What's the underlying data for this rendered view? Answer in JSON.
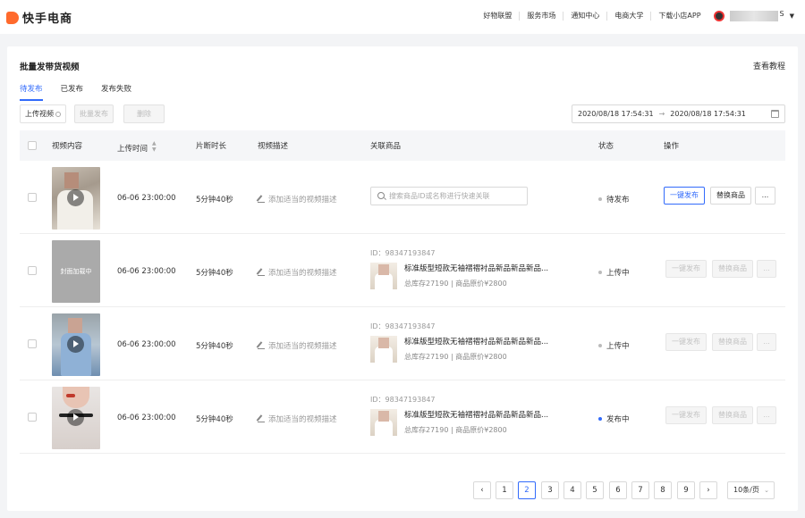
{
  "header": {
    "logo_text": "快手电商",
    "nav": [
      "好物联盟",
      "服务市场",
      "通知中心",
      "电商大学",
      "下载小店APP"
    ],
    "user_suffix": "S"
  },
  "page": {
    "title": "批量发带货视频",
    "tutorial_link": "查看教程",
    "tabs": [
      "待发布",
      "已发布",
      "发布失败"
    ],
    "toolbar": {
      "upload": "上传视频",
      "batch_publish": "批量发布",
      "delete": "删除"
    },
    "date_start": "2020/08/18 17:54:31",
    "date_end": "2020/08/18 17:54:31"
  },
  "table": {
    "headers": [
      "视频内容",
      "上传时间",
      "片断时长",
      "视频描述",
      "关联商品",
      "状态",
      "操作"
    ],
    "rows": [
      {
        "upload_time": "06-06 23:00:00",
        "duration": "5分钟40秒",
        "description": "添加适当的视频描述",
        "search_placeholder": "搜索商品ID或名称进行快速关联",
        "status": "待发布",
        "status_color": "#bbbbbb"
      },
      {
        "thumb_loading": "封面加载中",
        "upload_time": "06-06 23:00:00",
        "duration": "5分钟40秒",
        "description": "添加适当的视频描述",
        "product_id": "ID：98347193847",
        "product_name": "标准版型短款无袖褶褶衬品新品新品新品...",
        "product_stock": "总库存27190 | 商品原价¥2800",
        "status": "上传中",
        "status_color": "#bbbbbb"
      },
      {
        "upload_time": "06-06 23:00:00",
        "duration": "5分钟40秒",
        "description": "添加适当的视频描述",
        "product_id": "ID：98347193847",
        "product_name": "标准版型短款无袖褶褶衬品新品新品新品...",
        "product_stock": "总库存27190 | 商品原价¥2800",
        "status": "上传中",
        "status_color": "#bbbbbb"
      },
      {
        "upload_time": "06-06 23:00:00",
        "duration": "5分钟40秒",
        "description": "添加适当的视频描述",
        "product_id": "ID：98347193847",
        "product_name": "标准版型短款无袖褶褶衬品新品新品新品...",
        "product_stock": "总库存27190 | 商品原价¥2800",
        "status": "发布中",
        "status_color": "#326bfb"
      }
    ],
    "actions": {
      "publish": "一键发布",
      "replace": "替换商品",
      "more": "..."
    }
  },
  "pagination": {
    "prev": "‹",
    "next": "›",
    "pages": [
      "1",
      "2",
      "3",
      "4",
      "5",
      "6",
      "7",
      "8",
      "9"
    ],
    "current": "2",
    "page_size": "10条/页"
  },
  "colors": {
    "accent": "#326bfb",
    "brand": "#ff6a2c"
  }
}
